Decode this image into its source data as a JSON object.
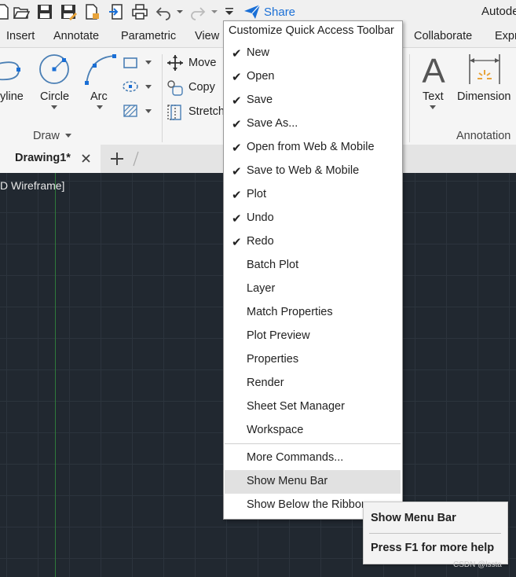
{
  "app": {
    "title": "Autodesk"
  },
  "qat": {
    "share_label": "Share"
  },
  "ribbon_tabs": [
    "Insert",
    "Annotate",
    "Parametric",
    "View",
    "Collaborate",
    "Express"
  ],
  "draw_panel": {
    "polyline": "yline",
    "circle": "Circle",
    "arc": "Arc",
    "title": "Draw"
  },
  "modify_panel": {
    "move": "Move",
    "copy": "Copy",
    "stretch": "Stretch"
  },
  "annotation_panel": {
    "text": "Text",
    "dimension": "Dimension",
    "title": "Annotation"
  },
  "file_tabs": {
    "active": "Drawing1*"
  },
  "viewport": {
    "state": "D Wireframe]"
  },
  "menu": {
    "title": "Customize Quick Access Toolbar",
    "items": [
      {
        "label": "New",
        "checked": true
      },
      {
        "label": "Open",
        "checked": true
      },
      {
        "label": "Save",
        "checked": true
      },
      {
        "label": "Save As...",
        "checked": true
      },
      {
        "label": "Open from Web & Mobile",
        "checked": true
      },
      {
        "label": "Save to Web & Mobile",
        "checked": true
      },
      {
        "label": "Plot",
        "checked": true
      },
      {
        "label": "Undo",
        "checked": true
      },
      {
        "label": "Redo",
        "checked": true
      },
      {
        "label": "Batch Plot",
        "checked": false
      },
      {
        "label": "Layer",
        "checked": false
      },
      {
        "label": "Match Properties",
        "checked": false
      },
      {
        "label": "Plot Preview",
        "checked": false
      },
      {
        "label": "Properties",
        "checked": false
      },
      {
        "label": "Render",
        "checked": false
      },
      {
        "label": "Sheet Set Manager",
        "checked": false
      },
      {
        "label": "Workspace",
        "checked": false
      }
    ],
    "more_commands": "More Commands...",
    "show_menu_bar": "Show Menu Bar",
    "show_below": "Show Below the Ribbon"
  },
  "tooltip": {
    "title": "Show Menu Bar",
    "help": "Press F1 for more help"
  },
  "watermark": "CSDN @lssta",
  "colors": {
    "accent": "#1a6fd6",
    "canvas": "#212830",
    "menu_highlight": "#e1e1e1"
  }
}
